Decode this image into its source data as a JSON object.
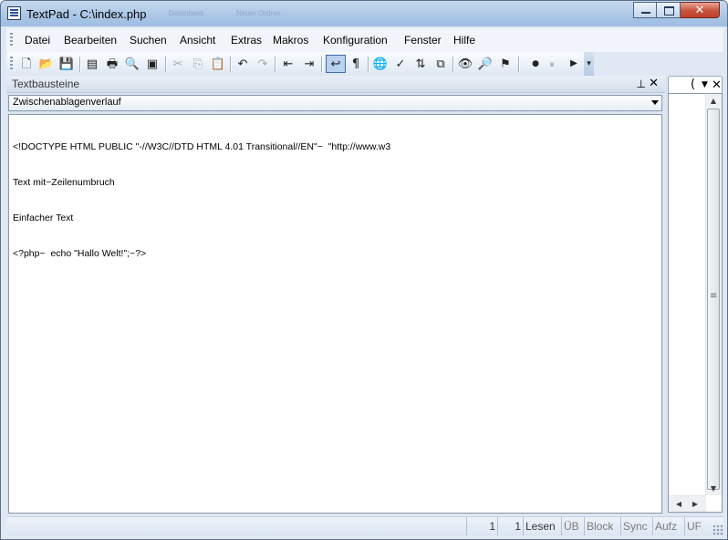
{
  "window": {
    "title": "TextPad - C:\\index.php",
    "ghost_title_1": "Datenbank",
    "ghost_title_2": "Neuer Ordner",
    "close_glyph": "✕"
  },
  "menu": [
    "Datei",
    "Bearbeiten",
    "Suchen",
    "Ansicht",
    "Extras",
    "Makros",
    "Konfiguration",
    "Fenster",
    "Hilfe"
  ],
  "toolbar": {
    "icons": [
      {
        "name": "new-file-icon",
        "glyph": "🗋"
      },
      {
        "name": "open-folder-icon",
        "glyph": "📂"
      },
      {
        "name": "save-icon",
        "glyph": "💾",
        "disabled": true
      },
      {
        "name": "manage-files-icon",
        "glyph": "▤"
      },
      {
        "name": "print-icon",
        "glyph": "🖶"
      },
      {
        "name": "print-preview-icon",
        "glyph": "🔍"
      },
      {
        "name": "spelling-icon",
        "glyph": "▣"
      },
      {
        "name": "cut-icon",
        "glyph": "✂",
        "disabled": true
      },
      {
        "name": "copy-icon",
        "glyph": "⎘",
        "disabled": true
      },
      {
        "name": "paste-icon",
        "glyph": "📋",
        "disabled": true
      },
      {
        "name": "undo-icon",
        "glyph": "↶"
      },
      {
        "name": "redo-icon",
        "glyph": "↷",
        "disabled": true
      },
      {
        "name": "decrease-indent-icon",
        "glyph": "⇤"
      },
      {
        "name": "increase-indent-icon",
        "glyph": "⇥"
      },
      {
        "name": "word-wrap-icon",
        "glyph": "↩",
        "active": true
      },
      {
        "name": "show-paragraph-icon",
        "glyph": "¶"
      },
      {
        "name": "web-browser-icon",
        "glyph": "🌐"
      },
      {
        "name": "spell-check-icon",
        "glyph": "✓"
      },
      {
        "name": "sort-icon",
        "glyph": "⇅"
      },
      {
        "name": "compare-files-icon",
        "glyph": "⧉"
      },
      {
        "name": "find-in-files-icon",
        "glyph": "👁"
      },
      {
        "name": "replace-icon",
        "glyph": "🔎"
      },
      {
        "name": "find-binoculars-icon",
        "glyph": "⚑"
      },
      {
        "name": "record-macro-icon",
        "glyph": "●"
      },
      {
        "name": "pause-macro-icon",
        "glyph": "⏸"
      },
      {
        "name": "play-macro-icon",
        "glyph": "▶"
      }
    ],
    "overflow_glyph": "▾"
  },
  "panel": {
    "title": "Textbausteine",
    "pin_glyph": "⊥",
    "close_glyph": "✕",
    "combo_value": "Zwischenablagenverlauf",
    "lines": [
      "<!DOCTYPE HTML PUBLIC \"-//W3C//DTD HTML 4.01 Transitional//EN\"~  \"http://www.w3",
      "Text mit~Zeilenumbruch",
      "Einfacher Text",
      "<?php~  echo \"Hallo Welt!\";~?>"
    ]
  },
  "side_panel": {
    "tab_glyph": "(",
    "drop_glyph": "▼",
    "close_glyph": "✕"
  },
  "status": {
    "line": "1",
    "column": "1",
    "mode": "Lesen",
    "overwrite": "ÜB",
    "block": "Block",
    "sync": "Sync",
    "record": "Aufz",
    "format": "UF"
  }
}
